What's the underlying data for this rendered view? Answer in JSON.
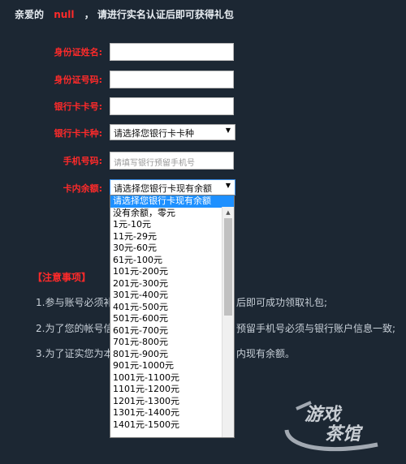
{
  "greeting": {
    "prefix": "亲爱的",
    "username": "null",
    "suffix": "， 请进行实名认证后即可获得礼包"
  },
  "form": {
    "name_label": "身份证姓名:",
    "id_label": "身份证号码:",
    "card_label": "银行卡卡号:",
    "card_type_label": "银行卡卡种:",
    "card_type_value": "请选择您银行卡卡种",
    "phone_label": "手机号码:",
    "phone_placeholder": "请填写银行预留手机号",
    "balance_label": "卡内余额:",
    "balance_value": "请选择您银行卡现有余额"
  },
  "notice": {
    "title": "【注意事项】",
    "line1_left": "1.参与账号必须补",
    "line1_right": "后即可成功领取礼包;",
    "line2_left": "2.为了您的帐号信",
    "line2_right": "预留手机号必须与银行账户信息一致;",
    "line3_left": "3.为了证实您为本",
    "line3_right": "内现有余额。"
  },
  "balance_options": [
    "请选择您银行卡现有余额",
    "没有余额，零元",
    "1元-10元",
    "11元-29元",
    "30元-60元",
    "61元-100元",
    "101元-200元",
    "201元-300元",
    "301元-400元",
    "401元-500元",
    "501元-600元",
    "601元-700元",
    "701元-800元",
    "801元-900元",
    "901元-1000元",
    "1001元-1100元",
    "1101元-1200元",
    "1201元-1300元",
    "1301元-1400元",
    "1401元-1500元"
  ],
  "watermark": "游戏茶馆",
  "colors": {
    "background": "#1c2733",
    "label_red": "#ff2a2a",
    "selected_option": "#1e90ff"
  }
}
